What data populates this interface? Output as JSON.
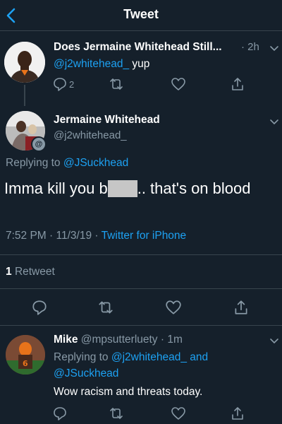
{
  "header": {
    "title": "Tweet"
  },
  "tweet1": {
    "name": "Does Jermaine Whitehead Still...",
    "time": "2h",
    "handle": "@j2whitehead_",
    "text": "yup",
    "reply_count": "2"
  },
  "main": {
    "name": "Jermaine Whitehead",
    "handle": "@j2whitehead_",
    "replying_prefix": "Replying to",
    "replying_handle": "@JSuckhead",
    "text_before": "Imma kill you b",
    "text_after": ".. that's on blood",
    "time": "7:52 PM · 11/3/19 ·",
    "client": "Twitter for iPhone",
    "retweet_count": "1",
    "retweet_label": "Retweet"
  },
  "reply": {
    "name": "Mike",
    "handle": "@mpsutterluety",
    "time": "· 1m",
    "replying_prefix": "Replying to",
    "replying_handle1": "@j2whitehead_",
    "replying_and": "and",
    "replying_handle2": "@JSuckhead",
    "text": "Wow racism and threats today."
  },
  "colors": {
    "background": "#15202b",
    "accent": "#1da1f2",
    "muted": "#8899a6",
    "divider": "#38444d"
  },
  "icons": [
    "back-arrow-icon",
    "chevron-down-icon",
    "reply-icon",
    "retweet-icon",
    "like-icon",
    "share-icon"
  ]
}
